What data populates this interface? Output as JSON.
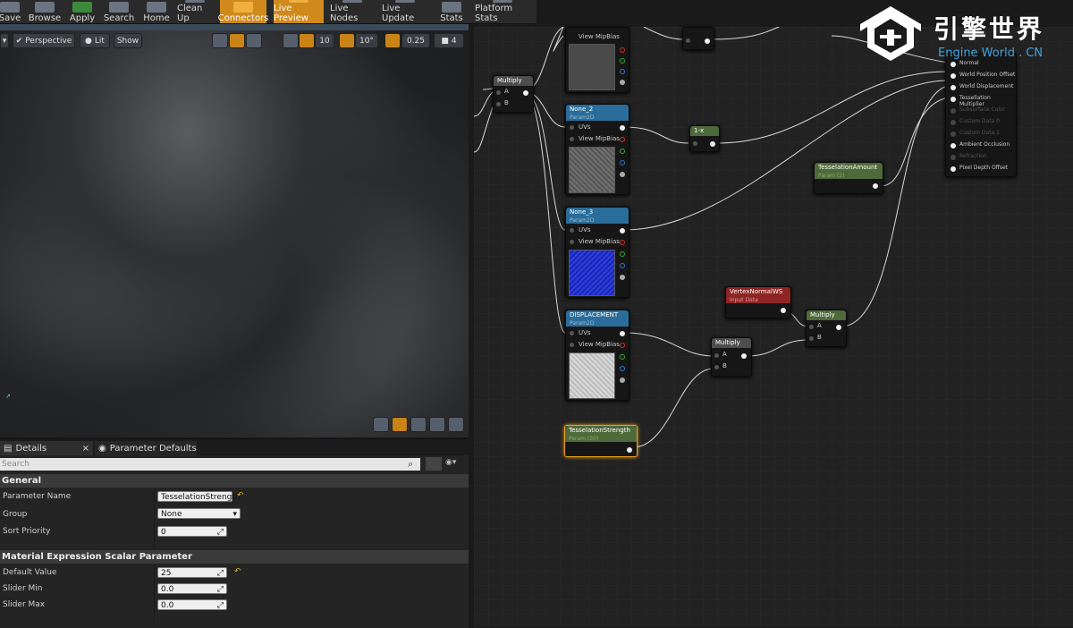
{
  "toolbar": {
    "buttons": [
      "Save",
      "Browse",
      "Apply",
      "Search",
      "Home",
      "Clean Up",
      "Connectors",
      "Live Preview",
      "Live Nodes",
      "Live Update",
      "Stats",
      "Platform Stats"
    ]
  },
  "viewport": {
    "perspective": "Perspective",
    "lit": "Lit",
    "show": "Show",
    "grid": "10",
    "angle": "10°",
    "scale": "0.25",
    "camspeed": "4"
  },
  "details": {
    "tab1": "Details",
    "tab2": "Parameter Defaults",
    "search_placeholder": "Search",
    "general": "General",
    "param_name_label": "Parameter Name",
    "param_name_value": "TesselationStrength",
    "group_label": "Group",
    "group_value": "None",
    "sort_label": "Sort Priority",
    "sort_value": "0",
    "scalar_section": "Material Expression Scalar Parameter",
    "default_label": "Default Value",
    "default_value": "25",
    "slidermin_label": "Slider Min",
    "slidermin_value": "0.0",
    "slidermax_label": "Slider Max",
    "slidermax_value": "0.0"
  },
  "graph": {
    "multiply": "Multiply",
    "a": "A",
    "b": "B",
    "uvs": "UVs",
    "mipbias": "View MipBias",
    "view_mipbias_top": "View MipBias",
    "param2d": "Param2D",
    "none2": "None_2",
    "none3": "None_3",
    "displacement": "DISPLACEMENT",
    "oneminus": "1-x",
    "tess_amount": "TesselationAmount",
    "tess_amount_sub": "Param (2)",
    "tess_strength": "TesselationStrength",
    "tess_strength_sub": "Param (30)",
    "vertexnormal": "VertexNormalWS",
    "vertexnormal_sub": "Input Data",
    "result_pins": [
      "Normal",
      "World Position Offset",
      "World Displacement",
      "Tessellation Multiplier",
      "Subsurface Color",
      "Custom Data 0",
      "Custom Data 1",
      "Ambient Occlusion",
      "Refraction",
      "Pixel Depth Offset"
    ]
  },
  "logo": {
    "cn": "引擎世界",
    "en": "Engine World . CN"
  }
}
